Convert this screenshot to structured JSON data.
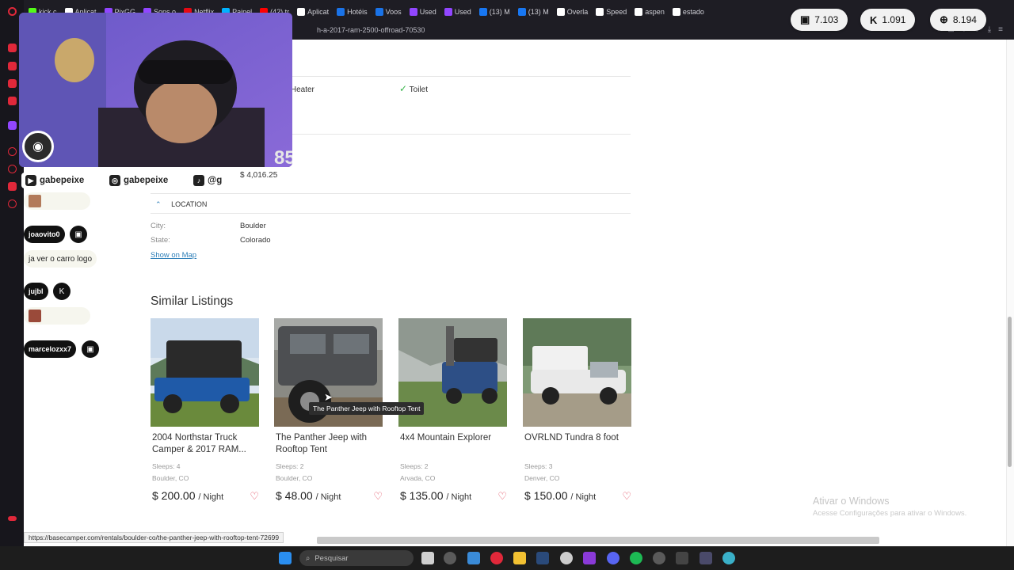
{
  "browser": {
    "tabs": [
      {
        "label": "kick.c",
        "color": "#53fc18"
      },
      {
        "label": "Aplicat",
        "color": "#ffffff"
      },
      {
        "label": "PixGG",
        "color": "#9146ff"
      },
      {
        "label": "Sons o",
        "color": "#9146ff"
      },
      {
        "label": "Netflix",
        "color": "#e50914"
      },
      {
        "label": "Painel",
        "color": "#00b2ff"
      },
      {
        "label": "(42) tr",
        "color": "#ff0000"
      },
      {
        "label": "Aplicat",
        "color": "#ffffff"
      },
      {
        "label": "Hotéis",
        "color": "#1a73e8"
      },
      {
        "label": "Voos",
        "color": "#1a73e8"
      },
      {
        "label": "Used",
        "color": "#9146ff"
      },
      {
        "label": "Used",
        "color": "#9146ff"
      },
      {
        "label": "(13) M",
        "color": "#1877f2"
      },
      {
        "label": "(13) M",
        "color": "#1877f2"
      },
      {
        "label": "Overla",
        "color": "#ffffff"
      },
      {
        "label": "Speed",
        "color": "#ffffff"
      },
      {
        "label": "aspen",
        "color": "#ffffff"
      },
      {
        "label": "estado",
        "color": "#ffffff"
      }
    ],
    "url": "h-a-2017-ram-2500-offroad-70530",
    "status_link": "https://basecamper.com/rentals/boulder-co/the-panther-jeep-with-rooftop-tent-72699"
  },
  "counters": [
    {
      "icon": "twitch-icon",
      "glyph": "▣",
      "value": "7.103"
    },
    {
      "icon": "kick-icon",
      "glyph": "K",
      "value": "1.091"
    },
    {
      "icon": "globe-icon",
      "glyph": "⊕",
      "value": "8.194"
    }
  ],
  "overlay": {
    "cam_number": "85",
    "socials": [
      {
        "icon": "youtube-icon",
        "glyph": "▶",
        "handle": "gabepeixe"
      },
      {
        "icon": "instagram-icon",
        "glyph": "◎",
        "handle": "gabepeixe"
      },
      {
        "icon": "tiktok-icon",
        "glyph": "♪",
        "handle": "@g"
      }
    ],
    "chat": [
      {
        "user": "joaovito0",
        "platform": "twitch"
      },
      {
        "message": "ja ver o carro logo"
      },
      {
        "user": "jujbl",
        "platform": "kick"
      },
      {
        "user": "marcelozxx7",
        "platform": "twitch"
      }
    ]
  },
  "amenities": [
    {
      "label": "Heater"
    },
    {
      "label": "Toilet"
    }
  ],
  "price_partial": "$ 4,016.25",
  "location": {
    "header": "LOCATION",
    "city_label": "City:",
    "city": "Boulder",
    "state_label": "State:",
    "state": "Colorado",
    "map_link": "Show on Map"
  },
  "similar": {
    "title": "Similar Listings",
    "listings": [
      {
        "title": "2004 Northstar Truck Camper & 2017 RAM...",
        "sleeps": "Sleeps: 4",
        "city": "Boulder, CO",
        "price": "$ 200.00",
        "unit": "/ Night"
      },
      {
        "title": "The Panther Jeep with Rooftop Tent",
        "sleeps": "Sleeps: 2",
        "city": "Boulder, CO",
        "price": "$ 48.00",
        "unit": "/ Night"
      },
      {
        "title": "4x4 Mountain Explorer",
        "sleeps": "Sleeps: 2",
        "city": "Arvada, CO",
        "price": "$ 135.00",
        "unit": "/ Night"
      },
      {
        "title": "OVRLND Tundra 8 foot",
        "sleeps": "Sleeps: 3",
        "city": "Denver, CO",
        "price": "$ 150.00",
        "unit": "/ Night"
      }
    ],
    "tooltip": "The Panther Jeep with Rooftop Tent"
  },
  "windows": {
    "watermark_title": "Ativar o Windows",
    "watermark_sub": "Acesse Configurações para ativar o Windows.",
    "search_placeholder": "Pesquisar"
  }
}
